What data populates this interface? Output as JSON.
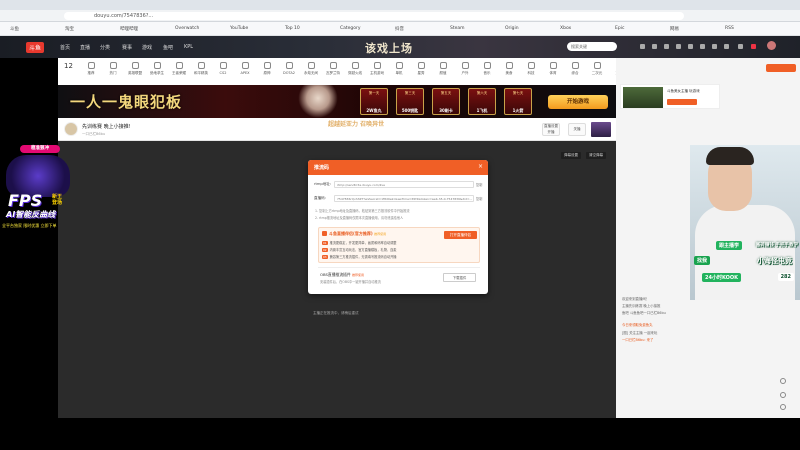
{
  "browser": {
    "url": "douyu.com/7547836?...",
    "bookmarks": [
      "斗鱼",
      "淘宝",
      "哔哩哔哩",
      "Overwatch",
      "YouTube",
      "Top 10",
      "Category",
      "抖音",
      "Steam",
      "Origin",
      "Xbox",
      "Epic",
      "网易",
      "RSS"
    ]
  },
  "site": {
    "logo": "斗鱼",
    "nav": [
      "首页",
      "直播",
      "分类",
      "赛事",
      "游戏",
      "鱼吧",
      "KPL"
    ],
    "brand_title": "该戏上场",
    "search_placeholder": "搜索关键"
  },
  "categories": {
    "day_number": "12",
    "items": [
      "推荐",
      "热门",
      "英雄联盟",
      "绝地求生",
      "王者荣耀",
      "和平精英",
      "CS2",
      "APEX",
      "原神",
      "DOTA2",
      "永劫无间",
      "瓦罗兰特",
      "穿越火线",
      "主机游戏",
      "单机",
      "星秀",
      "颜值",
      "户外",
      "音乐",
      "美食",
      "科技",
      "体育",
      "综合",
      "二次元",
      "更多"
    ]
  },
  "banner": {
    "title": "一人一鬼眼犯板",
    "prizes": [
      {
        "day": "第一天",
        "value": "2W鱼丸"
      },
      {
        "day": "第三天",
        "value": "500钥匙"
      },
      {
        "day": "第五天",
        "value": "30刷卡"
      },
      {
        "day": "第六天",
        "value": "1飞机"
      },
      {
        "day": "第七天",
        "value": "1火箭"
      }
    ],
    "start_label": "开始游戏"
  },
  "room": {
    "title": "先训练赛 晚上小接推!",
    "subtitle": "一口已栏B6bu",
    "promo": "超越延亚力 召唤异世",
    "buttons": [
      "直播设置 开播",
      "关播"
    ]
  },
  "player": {
    "top_buttons": [
      "弹幕设置",
      "清空弹幕"
    ],
    "hint": "主播正在推流中，请稍后重试"
  },
  "dialog": {
    "title": "推流码",
    "rtmp_label": "rtmp地址:",
    "rtmp_value": "rtmp://sendtc3a.douyu.com/live",
    "key_label": "直播码:",
    "key_value": "7547836rQvh3ZT?wsSecret=1f8d9e2c&wsTime=65f2&token=web-h5-0-7547836&did=...",
    "copy_label": "复制",
    "notes": [
      "1. 复制上方rtmp地址及直播码，粘贴到第三方推流软件中开始推流",
      "2. rtmp推流地址及直播码仅限本次直播使用，请勿泄露给他人"
    ],
    "obs": {
      "title": "斗鱼直播伴侣(官方推荐)",
      "tag": "推荐使用",
      "download": "打开直播伴侣",
      "steps": [
        {
          "n": "01",
          "t": "推流更稳定，开发更简单，画质和码率自动调整"
        },
        {
          "n": "02",
          "t": "内置丰富互动玩法，官方直播模板，礼物、连麦"
        },
        {
          "n": "03",
          "t": "兼容第三方推流插件，无需填写推流码自动开播"
        }
      ]
    },
    "plugin": {
      "title": "OBS直播推流插件",
      "tag": "推荐使用",
      "desc": "安装插件后，在OBS中一键开播并自动推流",
      "button": "下载插件"
    }
  },
  "right_panel": {
    "streamer_name": "斗鱼美女主播 玩游戏",
    "chat": [
      "欢迎来到直播间！",
      "主播先训练赛 晚上小接推",
      "鱼吧 斗鱼鱼吧一口已栏B6bu",
      "今日来领取免费鱼丸",
      "[图] 关注主播 一起来玩",
      "一口已栏B6bu: 来了"
    ]
  },
  "fps_overlay": {
    "badge": "稳准狠冲",
    "big": "FPS",
    "side": "新王\n登场",
    "ai": "AI智能反曲线",
    "promo": "全平台独家 限时优惠 立即下单"
  },
  "webcam": {
    "line1": "跟主播学",
    "line2": "搬砖赚钱 手把手教学",
    "line3": "小海怪电竞",
    "line3_pre": "找我",
    "line4": "24小时KOOK",
    "line4_num": "282"
  },
  "colors": {
    "accent": "#f05f26",
    "brand": "#e8392e",
    "player_bg": "#2b2b2b"
  }
}
